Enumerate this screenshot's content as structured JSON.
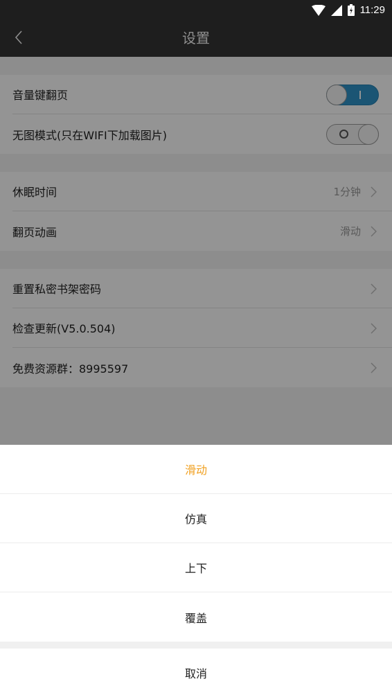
{
  "status_bar": {
    "time": "11:29",
    "icons": [
      "wifi-icon",
      "cellular-signal-icon",
      "battery-charging-icon"
    ]
  },
  "header": {
    "title": "设置",
    "back_icon": "chevron-left-icon"
  },
  "settings": {
    "groups": [
      {
        "items": [
          {
            "label": "音量键翻页",
            "control": "toggle",
            "state": true
          },
          {
            "label": "无图模式(只在WIFI下加载图片)",
            "control": "toggle",
            "state": false
          }
        ]
      },
      {
        "items": [
          {
            "label": "休眠时间",
            "value": "1分钟"
          },
          {
            "label": "翻页动画",
            "value": "滑动"
          }
        ]
      },
      {
        "items": [
          {
            "label": "重置私密书架密码"
          },
          {
            "label": "检查更新(V5.0.504)"
          },
          {
            "label": "免费资源群：8995597"
          }
        ]
      }
    ]
  },
  "sheet": {
    "options": [
      {
        "label": "滑动",
        "selected": true
      },
      {
        "label": "仿真",
        "selected": false
      },
      {
        "label": "上下",
        "selected": false
      },
      {
        "label": "覆盖",
        "selected": false
      }
    ],
    "cancel_label": "取消"
  },
  "colors": {
    "header_bg": "#1e1e1e",
    "toggle_on": "#2f93c8",
    "selected_option": "#f0a020"
  }
}
